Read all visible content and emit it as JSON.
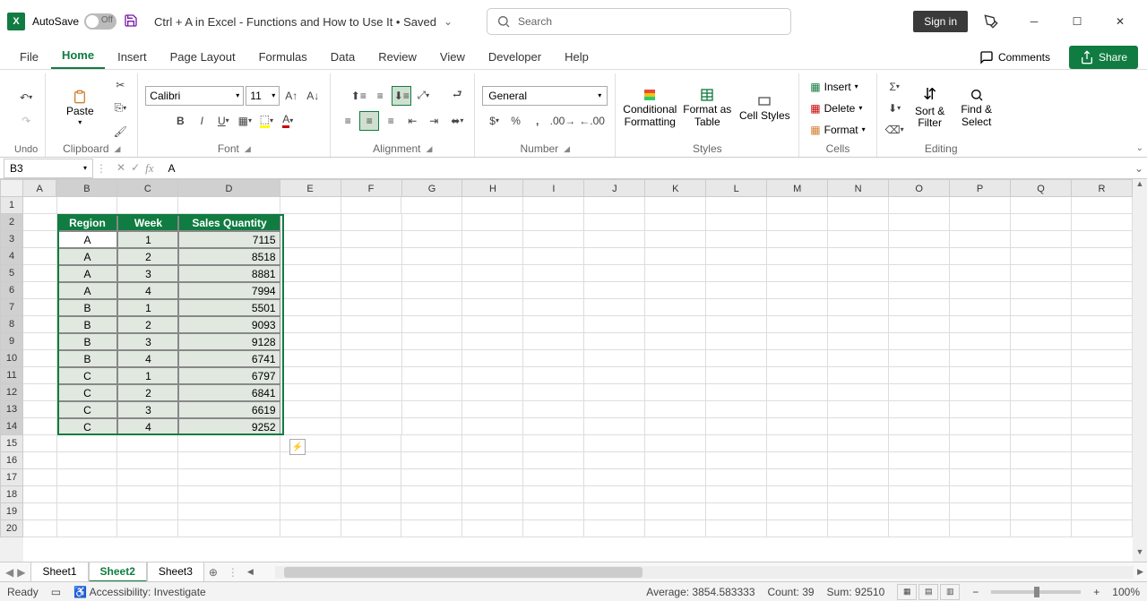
{
  "titlebar": {
    "autosave_label": "AutoSave",
    "autosave_state": "Off",
    "doc_title": "Ctrl + A in Excel - Functions and How to Use It • Saved",
    "search_placeholder": "Search",
    "signin": "Sign in"
  },
  "tabs": {
    "items": [
      "File",
      "Home",
      "Insert",
      "Page Layout",
      "Formulas",
      "Data",
      "Review",
      "View",
      "Developer",
      "Help"
    ],
    "active": "Home",
    "comments": "Comments",
    "share": "Share"
  },
  "ribbon": {
    "undo_label": "Undo",
    "clipboard": {
      "paste": "Paste",
      "label": "Clipboard"
    },
    "font": {
      "name": "Calibri",
      "size": "11",
      "label": "Font"
    },
    "alignment": {
      "label": "Alignment"
    },
    "number": {
      "format": "General",
      "label": "Number"
    },
    "styles": {
      "cond": "Conditional Formatting",
      "table": "Format as Table",
      "cell": "Cell Styles",
      "label": "Styles"
    },
    "cells": {
      "insert": "Insert",
      "delete": "Delete",
      "format": "Format",
      "label": "Cells"
    },
    "editing": {
      "sort": "Sort & Filter",
      "find": "Find & Select",
      "label": "Editing"
    }
  },
  "formula_bar": {
    "name_box": "B3",
    "value": "A"
  },
  "grid": {
    "columns": [
      "A",
      "B",
      "C",
      "D",
      "E",
      "F",
      "G",
      "H",
      "I",
      "J",
      "K",
      "L",
      "M",
      "N",
      "O",
      "P",
      "Q",
      "R"
    ],
    "selected_cols": [
      "B",
      "C",
      "D"
    ],
    "row_count": 20,
    "selected_rows": [
      2,
      3,
      4,
      5,
      6,
      7,
      8,
      9,
      10,
      11,
      12,
      13,
      14
    ],
    "active_cell": "B3",
    "headers": [
      "Region",
      "Week",
      "Sales Quantity"
    ],
    "data": [
      [
        "A",
        "1",
        "7115"
      ],
      [
        "A",
        "2",
        "8518"
      ],
      [
        "A",
        "3",
        "8881"
      ],
      [
        "A",
        "4",
        "7994"
      ],
      [
        "B",
        "1",
        "5501"
      ],
      [
        "B",
        "2",
        "9093"
      ],
      [
        "B",
        "3",
        "9128"
      ],
      [
        "B",
        "4",
        "6741"
      ],
      [
        "C",
        "1",
        "6797"
      ],
      [
        "C",
        "2",
        "6841"
      ],
      [
        "C",
        "3",
        "6619"
      ],
      [
        "C",
        "4",
        "9252"
      ]
    ]
  },
  "sheets": {
    "items": [
      "Sheet1",
      "Sheet2",
      "Sheet3"
    ],
    "active": "Sheet2"
  },
  "status": {
    "ready": "Ready",
    "accessibility": "Accessibility: Investigate",
    "average": "Average: 3854.583333",
    "count": "Count: 39",
    "sum": "Sum: 92510",
    "zoom": "100%"
  }
}
